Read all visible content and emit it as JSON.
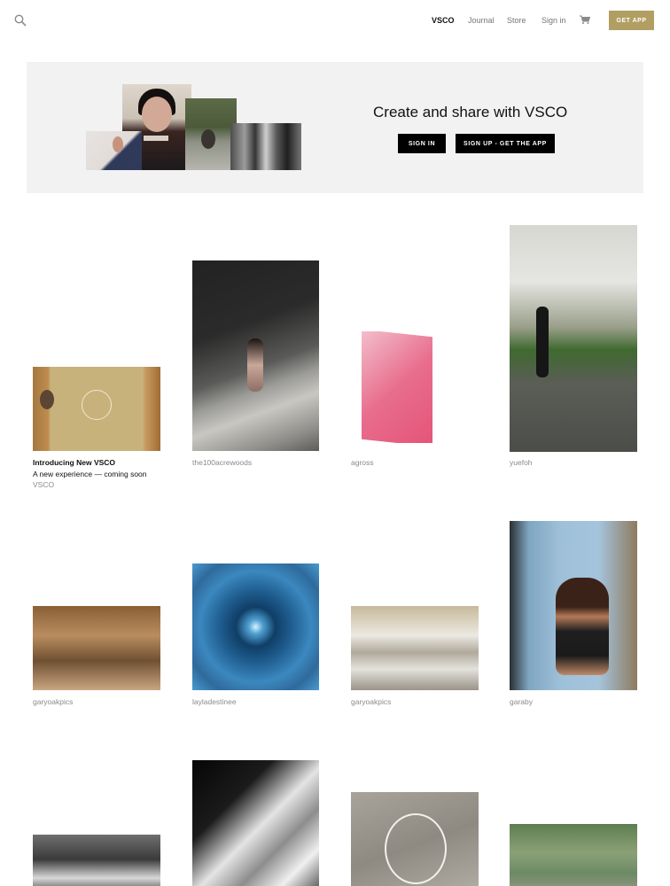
{
  "header": {
    "nav": [
      "VSCO",
      "Journal",
      "Store",
      "Sign in"
    ],
    "get_app": "GET APP"
  },
  "banner": {
    "title": "Create and share with VSCO",
    "sign_in": "SIGN IN",
    "sign_up": "SIGN UP - GET THE APP"
  },
  "feed": {
    "featured": {
      "title": "Introducing New VSCO",
      "subtitle": "A new experience — coming soon",
      "author": "VSCO"
    },
    "items": [
      "the100acrewoods",
      "agross",
      "yuefoh",
      "garyoakpics",
      "layladestinee",
      "garyoakpics",
      "garaby"
    ]
  },
  "icons": {
    "search": "search-icon",
    "cart": "cart-icon"
  },
  "colors": {
    "accent": "#b19e62",
    "banner_bg": "#f2f2f2",
    "button": "#000000"
  }
}
